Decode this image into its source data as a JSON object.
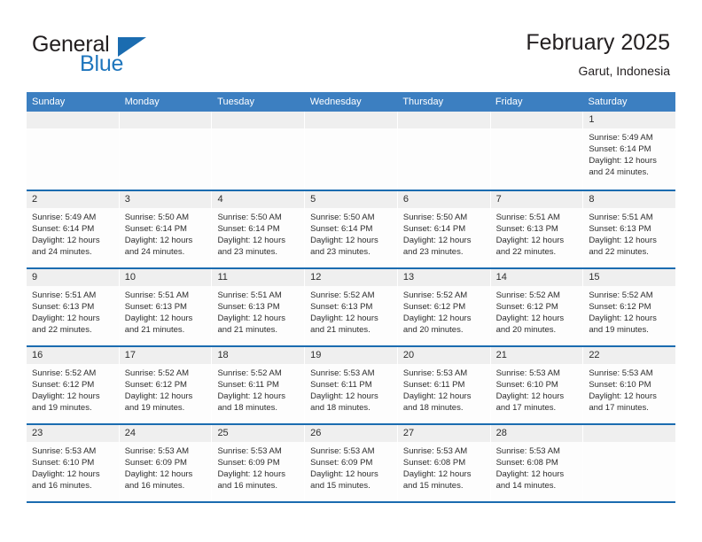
{
  "brand": {
    "word_one": "General",
    "word_two": "Blue",
    "triangle_color": "#1b6cb0",
    "accent_color": "#1f76bd"
  },
  "header": {
    "month_title": "February 2025",
    "location": "Garut, Indonesia"
  },
  "calendar": {
    "header_bg": "#3c7fc1",
    "row_border": "#1b6cb0",
    "daynum_bg": "#efefef",
    "weekdays": [
      "Sunday",
      "Monday",
      "Tuesday",
      "Wednesday",
      "Thursday",
      "Friday",
      "Saturday"
    ],
    "weeks": [
      [
        {
          "day": "",
          "empty": true
        },
        {
          "day": "",
          "empty": true
        },
        {
          "day": "",
          "empty": true
        },
        {
          "day": "",
          "empty": true
        },
        {
          "day": "",
          "empty": true
        },
        {
          "day": "",
          "empty": true
        },
        {
          "day": "1",
          "sunrise": "Sunrise: 5:49 AM",
          "sunset": "Sunset: 6:14 PM",
          "daylight1": "Daylight: 12 hours",
          "daylight2": "and 24 minutes."
        }
      ],
      [
        {
          "day": "2",
          "sunrise": "Sunrise: 5:49 AM",
          "sunset": "Sunset: 6:14 PM",
          "daylight1": "Daylight: 12 hours",
          "daylight2": "and 24 minutes."
        },
        {
          "day": "3",
          "sunrise": "Sunrise: 5:50 AM",
          "sunset": "Sunset: 6:14 PM",
          "daylight1": "Daylight: 12 hours",
          "daylight2": "and 24 minutes."
        },
        {
          "day": "4",
          "sunrise": "Sunrise: 5:50 AM",
          "sunset": "Sunset: 6:14 PM",
          "daylight1": "Daylight: 12 hours",
          "daylight2": "and 23 minutes."
        },
        {
          "day": "5",
          "sunrise": "Sunrise: 5:50 AM",
          "sunset": "Sunset: 6:14 PM",
          "daylight1": "Daylight: 12 hours",
          "daylight2": "and 23 minutes."
        },
        {
          "day": "6",
          "sunrise": "Sunrise: 5:50 AM",
          "sunset": "Sunset: 6:14 PM",
          "daylight1": "Daylight: 12 hours",
          "daylight2": "and 23 minutes."
        },
        {
          "day": "7",
          "sunrise": "Sunrise: 5:51 AM",
          "sunset": "Sunset: 6:13 PM",
          "daylight1": "Daylight: 12 hours",
          "daylight2": "and 22 minutes."
        },
        {
          "day": "8",
          "sunrise": "Sunrise: 5:51 AM",
          "sunset": "Sunset: 6:13 PM",
          "daylight1": "Daylight: 12 hours",
          "daylight2": "and 22 minutes."
        }
      ],
      [
        {
          "day": "9",
          "sunrise": "Sunrise: 5:51 AM",
          "sunset": "Sunset: 6:13 PM",
          "daylight1": "Daylight: 12 hours",
          "daylight2": "and 22 minutes."
        },
        {
          "day": "10",
          "sunrise": "Sunrise: 5:51 AM",
          "sunset": "Sunset: 6:13 PM",
          "daylight1": "Daylight: 12 hours",
          "daylight2": "and 21 minutes."
        },
        {
          "day": "11",
          "sunrise": "Sunrise: 5:51 AM",
          "sunset": "Sunset: 6:13 PM",
          "daylight1": "Daylight: 12 hours",
          "daylight2": "and 21 minutes."
        },
        {
          "day": "12",
          "sunrise": "Sunrise: 5:52 AM",
          "sunset": "Sunset: 6:13 PM",
          "daylight1": "Daylight: 12 hours",
          "daylight2": "and 21 minutes."
        },
        {
          "day": "13",
          "sunrise": "Sunrise: 5:52 AM",
          "sunset": "Sunset: 6:12 PM",
          "daylight1": "Daylight: 12 hours",
          "daylight2": "and 20 minutes."
        },
        {
          "day": "14",
          "sunrise": "Sunrise: 5:52 AM",
          "sunset": "Sunset: 6:12 PM",
          "daylight1": "Daylight: 12 hours",
          "daylight2": "and 20 minutes."
        },
        {
          "day": "15",
          "sunrise": "Sunrise: 5:52 AM",
          "sunset": "Sunset: 6:12 PM",
          "daylight1": "Daylight: 12 hours",
          "daylight2": "and 19 minutes."
        }
      ],
      [
        {
          "day": "16",
          "sunrise": "Sunrise: 5:52 AM",
          "sunset": "Sunset: 6:12 PM",
          "daylight1": "Daylight: 12 hours",
          "daylight2": "and 19 minutes."
        },
        {
          "day": "17",
          "sunrise": "Sunrise: 5:52 AM",
          "sunset": "Sunset: 6:12 PM",
          "daylight1": "Daylight: 12 hours",
          "daylight2": "and 19 minutes."
        },
        {
          "day": "18",
          "sunrise": "Sunrise: 5:52 AM",
          "sunset": "Sunset: 6:11 PM",
          "daylight1": "Daylight: 12 hours",
          "daylight2": "and 18 minutes."
        },
        {
          "day": "19",
          "sunrise": "Sunrise: 5:53 AM",
          "sunset": "Sunset: 6:11 PM",
          "daylight1": "Daylight: 12 hours",
          "daylight2": "and 18 minutes."
        },
        {
          "day": "20",
          "sunrise": "Sunrise: 5:53 AM",
          "sunset": "Sunset: 6:11 PM",
          "daylight1": "Daylight: 12 hours",
          "daylight2": "and 18 minutes."
        },
        {
          "day": "21",
          "sunrise": "Sunrise: 5:53 AM",
          "sunset": "Sunset: 6:10 PM",
          "daylight1": "Daylight: 12 hours",
          "daylight2": "and 17 minutes."
        },
        {
          "day": "22",
          "sunrise": "Sunrise: 5:53 AM",
          "sunset": "Sunset: 6:10 PM",
          "daylight1": "Daylight: 12 hours",
          "daylight2": "and 17 minutes."
        }
      ],
      [
        {
          "day": "23",
          "sunrise": "Sunrise: 5:53 AM",
          "sunset": "Sunset: 6:10 PM",
          "daylight1": "Daylight: 12 hours",
          "daylight2": "and 16 minutes."
        },
        {
          "day": "24",
          "sunrise": "Sunrise: 5:53 AM",
          "sunset": "Sunset: 6:09 PM",
          "daylight1": "Daylight: 12 hours",
          "daylight2": "and 16 minutes."
        },
        {
          "day": "25",
          "sunrise": "Sunrise: 5:53 AM",
          "sunset": "Sunset: 6:09 PM",
          "daylight1": "Daylight: 12 hours",
          "daylight2": "and 16 minutes."
        },
        {
          "day": "26",
          "sunrise": "Sunrise: 5:53 AM",
          "sunset": "Sunset: 6:09 PM",
          "daylight1": "Daylight: 12 hours",
          "daylight2": "and 15 minutes."
        },
        {
          "day": "27",
          "sunrise": "Sunrise: 5:53 AM",
          "sunset": "Sunset: 6:08 PM",
          "daylight1": "Daylight: 12 hours",
          "daylight2": "and 15 minutes."
        },
        {
          "day": "28",
          "sunrise": "Sunrise: 5:53 AM",
          "sunset": "Sunset: 6:08 PM",
          "daylight1": "Daylight: 12 hours",
          "daylight2": "and 14 minutes."
        },
        {
          "day": "",
          "empty": true
        }
      ]
    ]
  }
}
